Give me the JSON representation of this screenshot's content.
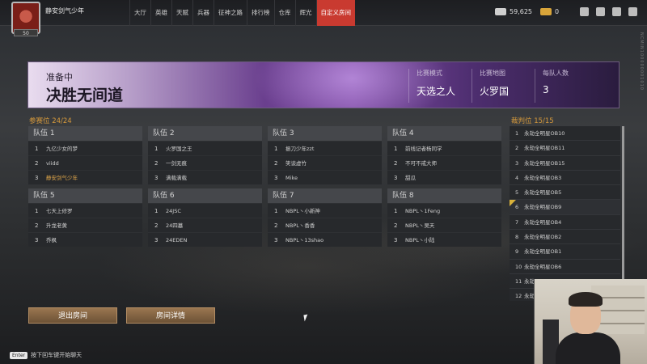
{
  "player": {
    "name": "静安剑气少年",
    "level": "50"
  },
  "nav": {
    "items": [
      "大厅",
      "英雄",
      "天赋",
      "兵器",
      "征神之路",
      "排行榜",
      "仓库",
      "辉光",
      "自定义房间"
    ],
    "active_index": 8
  },
  "resources": {
    "coins": "59,625",
    "gold": "0"
  },
  "side_text": "NCMIN100000001010",
  "banner": {
    "status": "准备中",
    "title": "决胜无间道",
    "mode_label": "比赛模式",
    "mode_value": "天选之人",
    "map_label": "比赛地图",
    "map_value": "火罗国",
    "team_size_label": "每队人数",
    "team_size_value": "3"
  },
  "participants_label": "参赛位",
  "participants_count": "24/24",
  "referees_label": "裁判位",
  "referees_count": "15/15",
  "teams": [
    {
      "name": "队伍 1",
      "members": [
        {
          "num": "1",
          "name": "九亿少女的梦"
        },
        {
          "num": "2",
          "name": "viidd"
        },
        {
          "num": "3",
          "name": "静安剑气少年"
        }
      ]
    },
    {
      "name": "队伍 2",
      "members": [
        {
          "num": "1",
          "name": "火罗国之王"
        },
        {
          "num": "2",
          "name": "一剑无痕"
        },
        {
          "num": "3",
          "name": "满载满载"
        }
      ]
    },
    {
      "name": "队伍 3",
      "members": [
        {
          "num": "1",
          "name": "振刀少年zzt"
        },
        {
          "num": "2",
          "name": "笑谈虚竹"
        },
        {
          "num": "3",
          "name": "Mike"
        }
      ]
    },
    {
      "name": "队伍 4",
      "members": [
        {
          "num": "1",
          "name": "前线记者杨同学"
        },
        {
          "num": "2",
          "name": "不可不戒大师"
        },
        {
          "num": "3",
          "name": "甜瓜"
        }
      ]
    },
    {
      "name": "队伍 5",
      "members": [
        {
          "num": "1",
          "name": "七天上修罗"
        },
        {
          "num": "2",
          "name": "升龙老黄"
        },
        {
          "num": "3",
          "name": "乔枫"
        }
      ]
    },
    {
      "name": "队伍 6",
      "members": [
        {
          "num": "1",
          "name": "24JSC"
        },
        {
          "num": "2",
          "name": "24四墓"
        },
        {
          "num": "3",
          "name": "24EDEN"
        }
      ]
    },
    {
      "name": "队伍 7",
      "members": [
        {
          "num": "1",
          "name": "NBPL丶小新神"
        },
        {
          "num": "2",
          "name": "NBPL丶香香"
        },
        {
          "num": "3",
          "name": "NBPL丶13shao"
        }
      ]
    },
    {
      "name": "队伍 8",
      "members": [
        {
          "num": "1",
          "name": "NBPL丶1Feng"
        },
        {
          "num": "2",
          "name": "NBPL丶吴天"
        },
        {
          "num": "3",
          "name": "NBPL丶小陆"
        }
      ]
    }
  ],
  "referees": [
    {
      "num": "1",
      "name": "永劫全明星OB10"
    },
    {
      "num": "2",
      "name": "永劫全明星OB11"
    },
    {
      "num": "3",
      "name": "永劫全明星OB15"
    },
    {
      "num": "4",
      "name": "永劫全明星OB3"
    },
    {
      "num": "5",
      "name": "永劫全明星OB5"
    },
    {
      "num": "6",
      "name": "永劫全明星OB9"
    },
    {
      "num": "7",
      "name": "永劫全明星OB4"
    },
    {
      "num": "8",
      "name": "永劫全明星OB2"
    },
    {
      "num": "9",
      "name": "永劫全明星OB1"
    },
    {
      "num": "10",
      "name": "永劫全明星OB6"
    },
    {
      "num": "11",
      "name": "永劫"
    },
    {
      "num": "12",
      "name": "永劫"
    }
  ],
  "buttons": {
    "exit_room": "退出房间",
    "room_details": "房间详情"
  },
  "chat": {
    "key": "Enter",
    "hint": "按下回车键开始聊天"
  },
  "colors": {
    "accent": "#c93a30",
    "gold": "#d79a3c",
    "me_highlight": "#e0a64a"
  }
}
